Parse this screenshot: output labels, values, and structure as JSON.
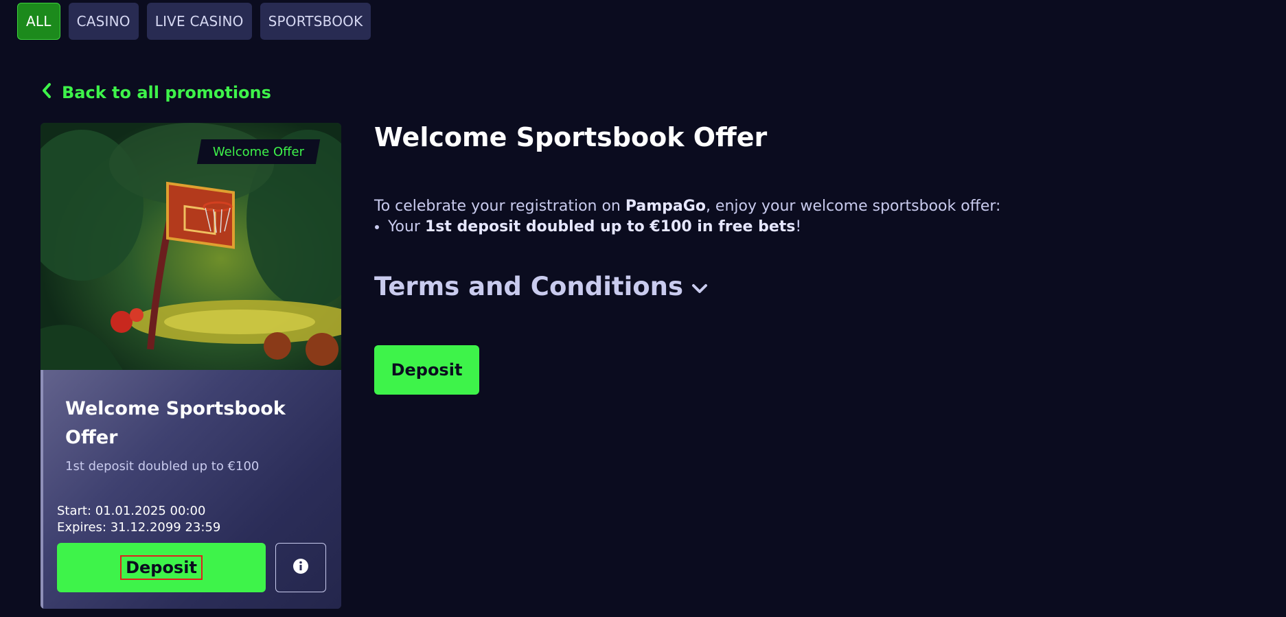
{
  "tabs": [
    {
      "label": "ALL",
      "active": true
    },
    {
      "label": "CASINO",
      "active": false
    },
    {
      "label": "LIVE CASINO",
      "active": false
    },
    {
      "label": "SPORTSBOOK",
      "active": false
    }
  ],
  "back_link": {
    "label": "Back to all promotions",
    "icon": "chevron-left-icon"
  },
  "card": {
    "badge": "Welcome Offer",
    "title": "Welcome Sportsbook Offer",
    "subtitle": "1st deposit doubled up to €100",
    "start": "Start: 01.01.2025 00:00",
    "expires": "Expires: 31.12.2099 23:59",
    "deposit_label": "Deposit",
    "info_icon": "info-icon"
  },
  "main": {
    "title": "Welcome Sportsbook Offer",
    "intro_prefix": "To celebrate your registration on ",
    "brand": "PampaGo",
    "intro_suffix": ", enjoy your welcome sportsbook offer:",
    "bullet_prefix": "Your ",
    "bullet_bold": "1st deposit doubled up to €100 in free bets",
    "bullet_suffix": "!",
    "terms_label": "Terms and Conditions",
    "terms_icon": "chevron-down-icon",
    "deposit_label": "Deposit"
  },
  "colors": {
    "background": "#0b0c1f",
    "accent_green": "#3ef34a",
    "tab_active": "#1c8a1c",
    "tab_inactive": "#282b52",
    "highlight_box": "#e0201e"
  }
}
